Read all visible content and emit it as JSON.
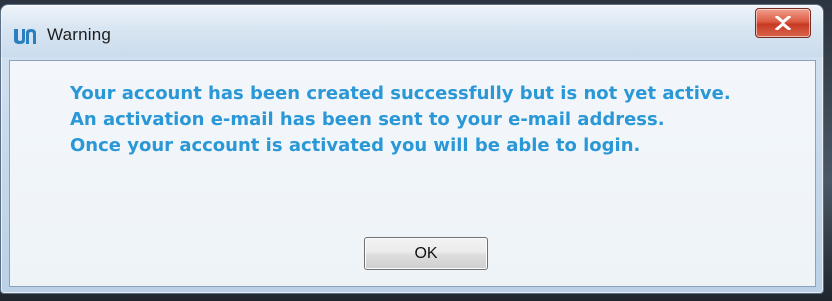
{
  "dialog": {
    "title": "Warning",
    "close_label": "X",
    "message_lines": [
      "Your account has been created successfully but is not yet active.",
      "An activation e-mail has been sent to your e-mail address.",
      "Once your account is activated you will be able to login."
    ],
    "ok_label": "OK",
    "app_icon": "un-logo-icon"
  },
  "colors": {
    "message": "#2a97d6",
    "logo": "#2a7fc0",
    "close_button": "#c63a24"
  }
}
